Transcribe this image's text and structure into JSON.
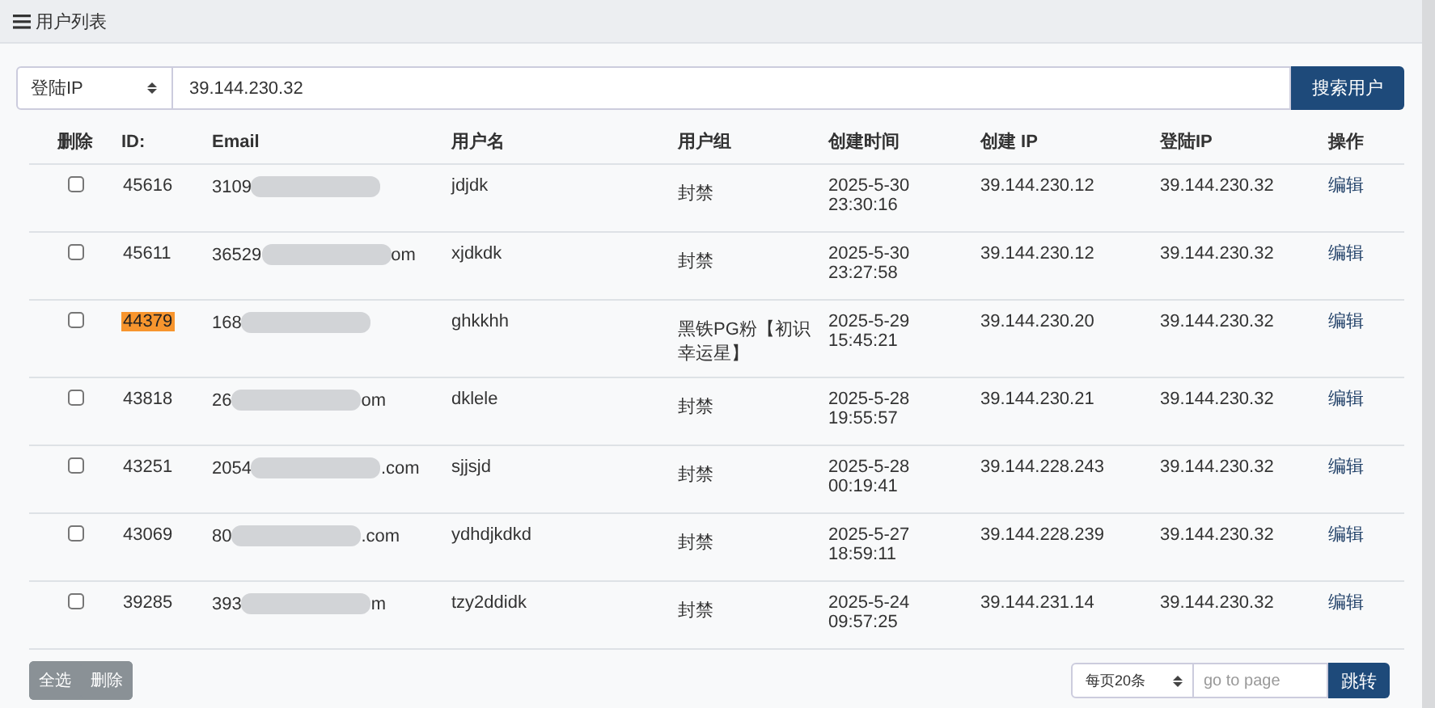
{
  "panel": {
    "title": "用户列表"
  },
  "search": {
    "field": "登陆IP",
    "value": "39.144.230.32",
    "button": "搜索用户"
  },
  "table": {
    "columns": [
      "删除",
      "ID:",
      "Email",
      "用户名",
      "用户组",
      "创建时间",
      "创建 IP",
      "登陆IP",
      "操作"
    ],
    "rows": [
      {
        "checked": false,
        "id": "45616",
        "highlighted": false,
        "email_start": "3109",
        "email_end": "",
        "username": "jdjdk",
        "group": "封禁",
        "created": "2025-5-30 23:30:16",
        "create_ip": "39.144.230.12",
        "login_ip": "39.144.230.32",
        "action": "编辑"
      },
      {
        "checked": false,
        "id": "45611",
        "highlighted": false,
        "email_start": "36529",
        "email_end": "om",
        "username": "xjdkdk",
        "group": "封禁",
        "created": "2025-5-30 23:27:58",
        "create_ip": "39.144.230.12",
        "login_ip": "39.144.230.32",
        "action": "编辑"
      },
      {
        "checked": false,
        "id": "44379",
        "highlighted": true,
        "email_start": "168",
        "email_end": "",
        "username": "ghkkhh",
        "group": "黑铁PG粉【初识幸运星】",
        "created": "2025-5-29 15:45:21",
        "create_ip": "39.144.230.20",
        "login_ip": "39.144.230.32",
        "action": "编辑"
      },
      {
        "checked": false,
        "id": "43818",
        "highlighted": false,
        "email_start": "26",
        "email_end": "om",
        "username": "dklele",
        "group": "封禁",
        "created": "2025-5-28 19:55:57",
        "create_ip": "39.144.230.21",
        "login_ip": "39.144.230.32",
        "action": "编辑"
      },
      {
        "checked": false,
        "id": "43251",
        "highlighted": false,
        "email_start": "2054",
        "email_end": ".com",
        "username": "sjjsjd",
        "group": "封禁",
        "created": "2025-5-28 00:19:41",
        "create_ip": "39.144.228.243",
        "login_ip": "39.144.230.32",
        "action": "编辑"
      },
      {
        "checked": false,
        "id": "43069",
        "highlighted": false,
        "email_start": "80",
        "email_end": ".com",
        "username": "ydhdjkdkd",
        "group": "封禁",
        "created": "2025-5-27 18:59:11",
        "create_ip": "39.144.228.239",
        "login_ip": "39.144.230.32",
        "action": "编辑"
      },
      {
        "checked": false,
        "id": "39285",
        "highlighted": false,
        "email_start": "393",
        "email_end": "m",
        "username": "tzy2ddidk",
        "group": "封禁",
        "created": "2025-5-24 09:57:25",
        "create_ip": "39.144.231.14",
        "login_ip": "39.144.230.32",
        "action": "编辑"
      }
    ]
  },
  "footer": {
    "buttons": [
      "全选",
      "删除"
    ],
    "page_size": "每页20条",
    "page_placeholder": "go to page",
    "jump": "跳转"
  }
}
